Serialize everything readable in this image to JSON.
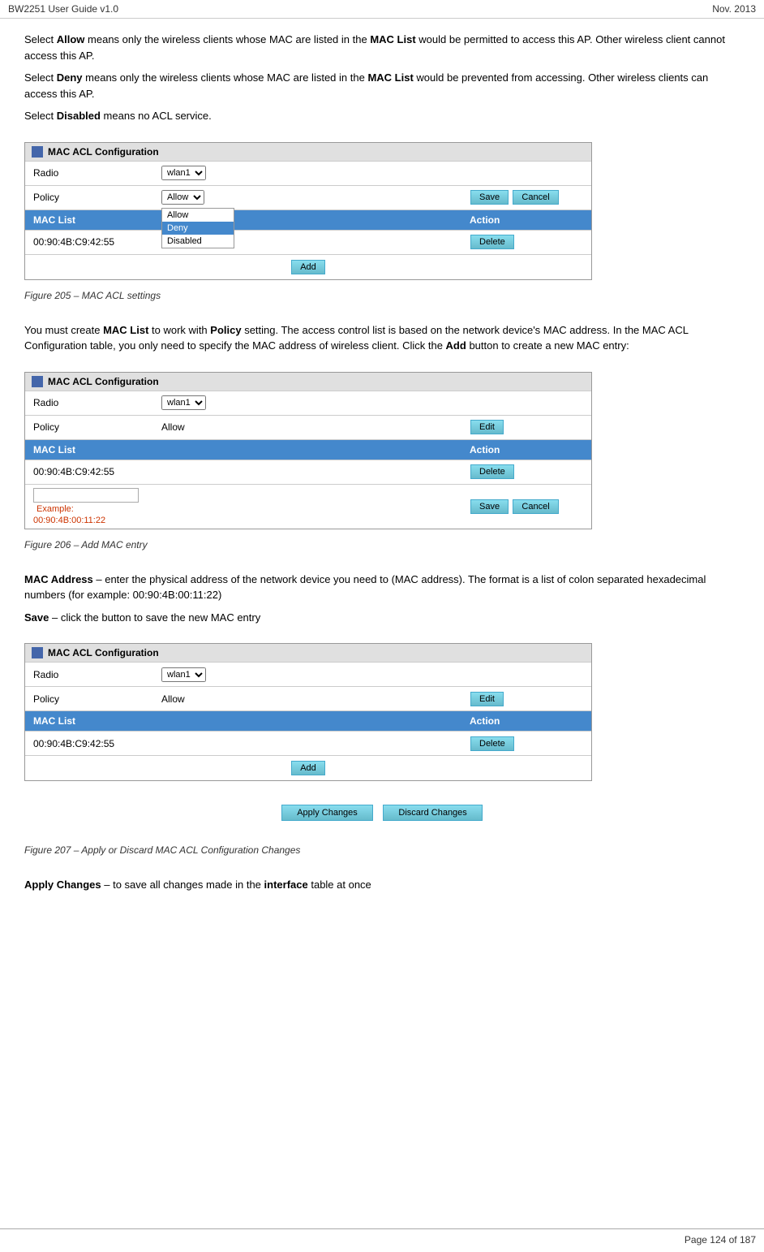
{
  "header": {
    "title": "BW2251 User Guide v1.0",
    "date": "Nov.  2013"
  },
  "footer": {
    "page_info": "Page 124 of 187"
  },
  "content": {
    "para1": "Select ",
    "para1_bold1": "Allow",
    "para1_rest": " means only the wireless clients whose MAC are listed in the ",
    "para1_bold2": "MAC List",
    "para1_end": " would be permitted to access this AP. Other wireless client cannot access this AP.",
    "para2": "Select ",
    "para2_bold1": "Deny",
    "para2_rest": " means only the wireless clients whose MAC are listed in the ",
    "para2_bold2": "MAC List",
    "para2_end": " would be prevented from accessing. Other wireless clients can access this AP.",
    "para3": "Select ",
    "para3_bold": "Disabled",
    "para3_end": " means no ACL service.",
    "table1_title": "MAC ACL Configuration",
    "table1_radio_label": "Radio",
    "table1_radio_value": "wlan1",
    "table1_policy_label": "Policy",
    "table1_policy_value": "Allow",
    "table1_save_btn": "Save",
    "table1_cancel_btn": "Cancel",
    "table1_maclist_label": "MAC List",
    "table1_action_label": "Action",
    "table1_mac_value": "00:90:4B:C9:42:55",
    "table1_delete_btn": "Delete",
    "table1_add_btn": "Add",
    "dropdown_items": [
      "Allow",
      "Deny",
      "Disabled"
    ],
    "dropdown_selected": "Deny",
    "fig1_caption": "Figure 205 – MAC ACL settings",
    "body_text1": "You must create ",
    "body_bold1": "MAC List",
    "body_text1b": " to work with ",
    "body_bold2": "Policy",
    "body_text1c": " setting. The access control list is based on the network device's MAC address. In the MAC ACL Configuration table, you only need to specify the MAC address of wireless client. Click the ",
    "body_bold3": "Add",
    "body_text1d": " button to create a new MAC entry:",
    "table2_title": "MAC ACL Configuration",
    "table2_radio_label": "Radio",
    "table2_radio_value": "wlan1",
    "table2_policy_label": "Policy",
    "table2_policy_value": "Allow",
    "table2_edit_btn": "Edit",
    "table2_maclist_label": "MAC List",
    "table2_action_label": "Action",
    "table2_mac_value": "00:90:4B:C9:42:55",
    "table2_delete_btn": "Delete",
    "table2_input_placeholder": "",
    "table2_example": "Example: 00:90:4B:00:11:22",
    "table2_save_btn": "Save",
    "table2_cancel_btn": "Cancel",
    "fig2_caption": "Figure 206 – Add MAC entry",
    "body2_text1": "MAC Address",
    "body2_text1b": " – enter the physical address of the network device you need to (MAC address). The format is a list of colon separated hexadecimal numbers (for example: 00:90:4B:00:11:22)",
    "body2_text2": "Save",
    "body2_text2b": " – click the button to save the new MAC entry",
    "table3_title": "MAC ACL Configuration",
    "table3_radio_label": "Radio",
    "table3_radio_value": "wlan1",
    "table3_policy_label": "Policy",
    "table3_policy_value": "Allow",
    "table3_edit_btn": "Edit",
    "table3_maclist_label": "MAC List",
    "table3_action_label": "Action",
    "table3_mac_value": "00:90:4B:C9:42:55",
    "table3_delete_btn": "Delete",
    "table3_add_btn": "Add",
    "table3_apply_btn": "Apply Changes",
    "table3_discard_btn": "Discard Changes",
    "fig3_caption": "Figure 207 – Apply or Discard MAC ACL Configuration Changes",
    "body3_text1": "Apply Changes",
    "body3_text1b": " – to save all changes made in the ",
    "body3_bold": "interface",
    "body3_text1c": " table at once"
  }
}
